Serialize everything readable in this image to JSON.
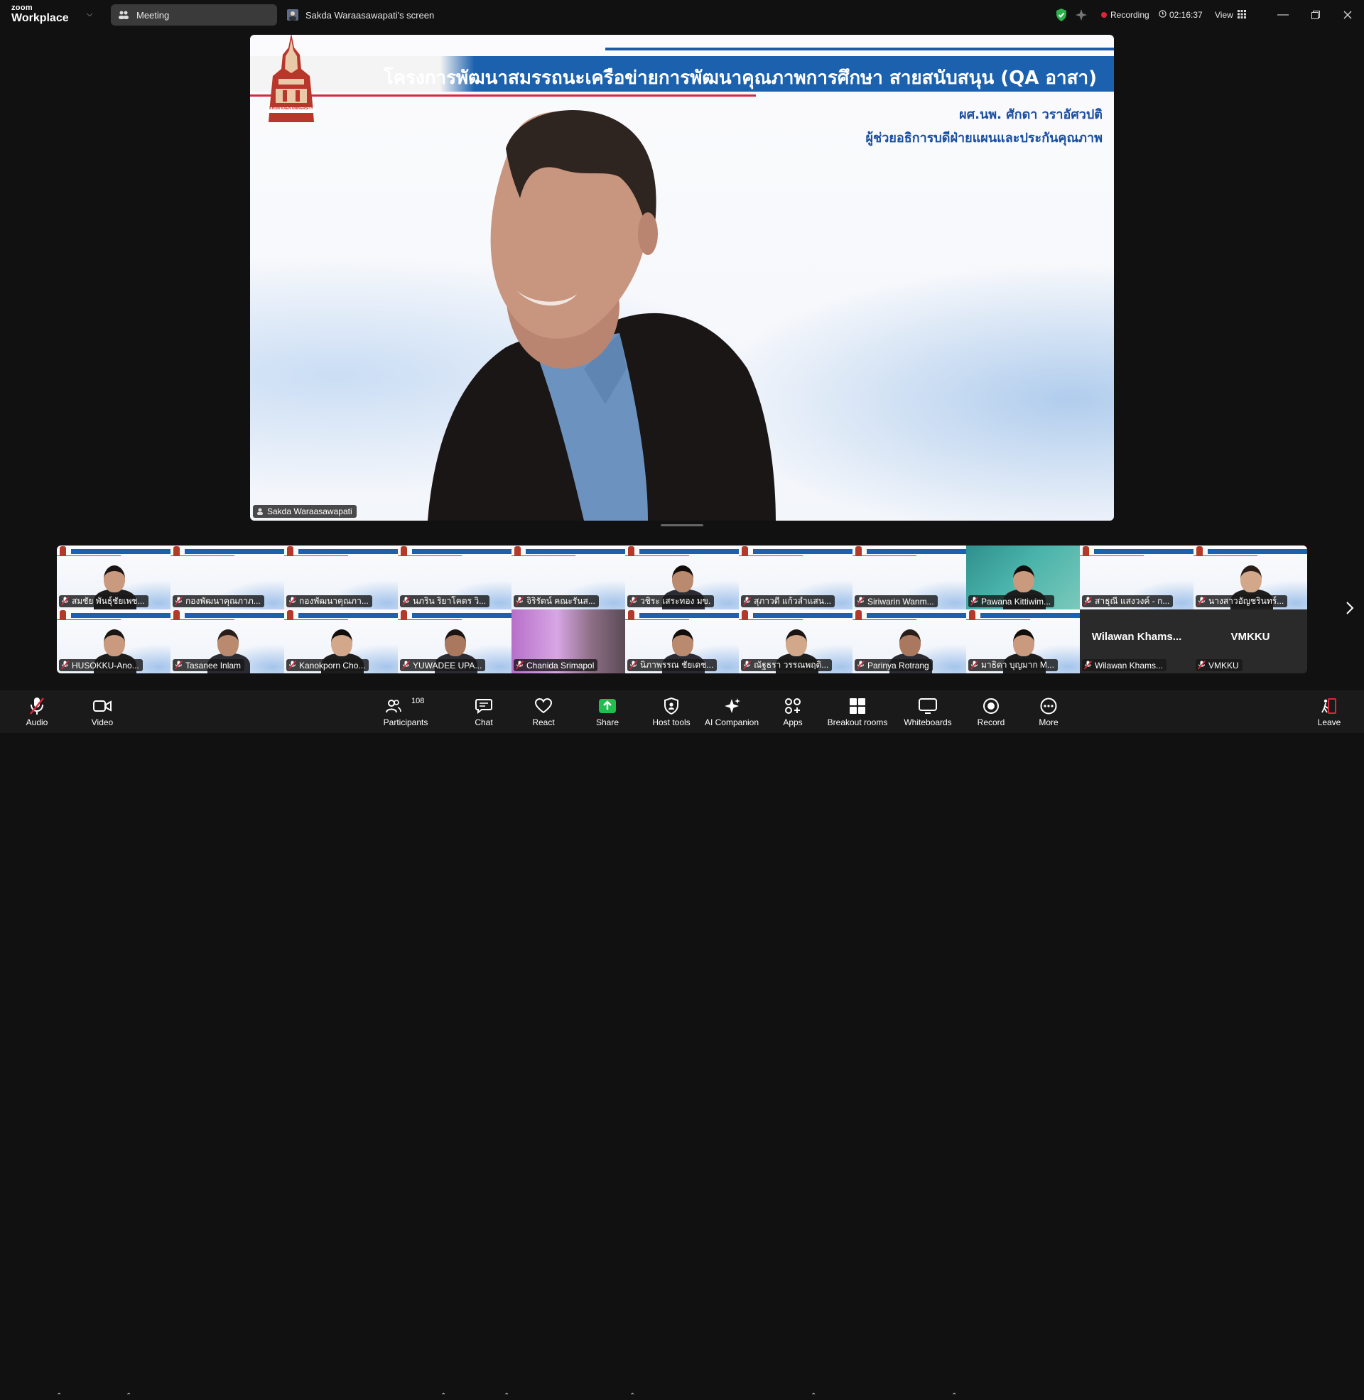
{
  "app": {
    "logo_line1": "zoom",
    "logo_line2": "Workplace"
  },
  "tabs": {
    "meeting": "Meeting",
    "screen_share": "Sakda Waraasawapati's screen"
  },
  "status": {
    "recording_label": "Recording",
    "recording_color": "#e0243a",
    "timer": "02:16:37",
    "view_label": "View",
    "secure_color": "#2ab24a"
  },
  "main_video": {
    "slide_title": "โครงการพัฒนาสมรรถนะเครือข่ายการพัฒนาคุณภาพการศึกษา สายสนับสนุน (QA อาสา)",
    "presenter_name": "ผศ.นพ. ศักดา วราอัศวปติ",
    "presenter_role": "ผู้ช่วยอธิการบดีฝ่ายแผนและประกันคุณภาพ",
    "logo_caption": "KHON KAEN UNIVERSITY",
    "speaker_tag": "Sakda Waraasawapati"
  },
  "participants_row1": [
    {
      "name": "สมชัย พันธ์ุชัยเพช...",
      "style": "slide",
      "face": true
    },
    {
      "name": "กองพัฒนาคุณภาภ...",
      "style": "slide",
      "face": false
    },
    {
      "name": "กองพัฒนาคุณภา...",
      "style": "slide",
      "face": false
    },
    {
      "name": "นภริน ริยาโคตร วิ...",
      "style": "slide",
      "face": false
    },
    {
      "name": "จิริรัตน์ คณะรันส...",
      "style": "slide",
      "face": false
    },
    {
      "name": "วชิระ เสระทอง มข.",
      "style": "slide",
      "face": true
    },
    {
      "name": "สุภาวดี แก้วลำแสน...",
      "style": "slide",
      "face": false
    },
    {
      "name": "Siriwarin Wanm...",
      "style": "slide",
      "face": false
    },
    {
      "name": "Pawana Kittiwim...",
      "style": "flowers",
      "face": true
    },
    {
      "name": "สาธุณี แสงวงค์ - ก...",
      "style": "slide",
      "face": false
    },
    {
      "name": "นางสาวอัญชรินทร์...",
      "style": "slide",
      "face": true
    }
  ],
  "participants_row2": [
    {
      "name": "HUSOKKU-Ano...",
      "style": "slide",
      "face": true
    },
    {
      "name": "Tasanee Inlam",
      "style": "slide",
      "face": true
    },
    {
      "name": "Kanokporn Cho...",
      "style": "slide",
      "face": true
    },
    {
      "name": "YUWADEE UPA...",
      "style": "slide",
      "face": true
    },
    {
      "name": "Chanida Srimapol",
      "style": "blur",
      "face": false
    },
    {
      "name": "นิภาพรรณ ชัยเดช...",
      "style": "slide",
      "face": true
    },
    {
      "name": "ณัฐธรา วรรณพฤติ...",
      "style": "slide",
      "face": true
    },
    {
      "name": "Parinya Rotrang",
      "style": "slide",
      "face": true
    },
    {
      "name": "มาธิดา บุญมาก M...",
      "style": "slide",
      "face": true
    },
    {
      "name": "Wilawan Khams...",
      "style": "dark",
      "big": "Wilawan  Khams...",
      "face": false
    },
    {
      "name": "VMKKU",
      "style": "dark",
      "big": "VMKKU",
      "face": false
    }
  ],
  "toolbar": {
    "audio": "Audio",
    "video": "Video",
    "participants": "Participants",
    "participants_count": "108",
    "chat": "Chat",
    "react": "React",
    "share": "Share",
    "host_tools": "Host tools",
    "ai_companion": "AI Companion",
    "apps": "Apps",
    "breakout_rooms": "Breakout rooms",
    "whiteboards": "Whiteboards",
    "record": "Record",
    "more": "More",
    "leave": "Leave",
    "share_color": "#1fbf4f",
    "mute_color": "#e0243a"
  }
}
